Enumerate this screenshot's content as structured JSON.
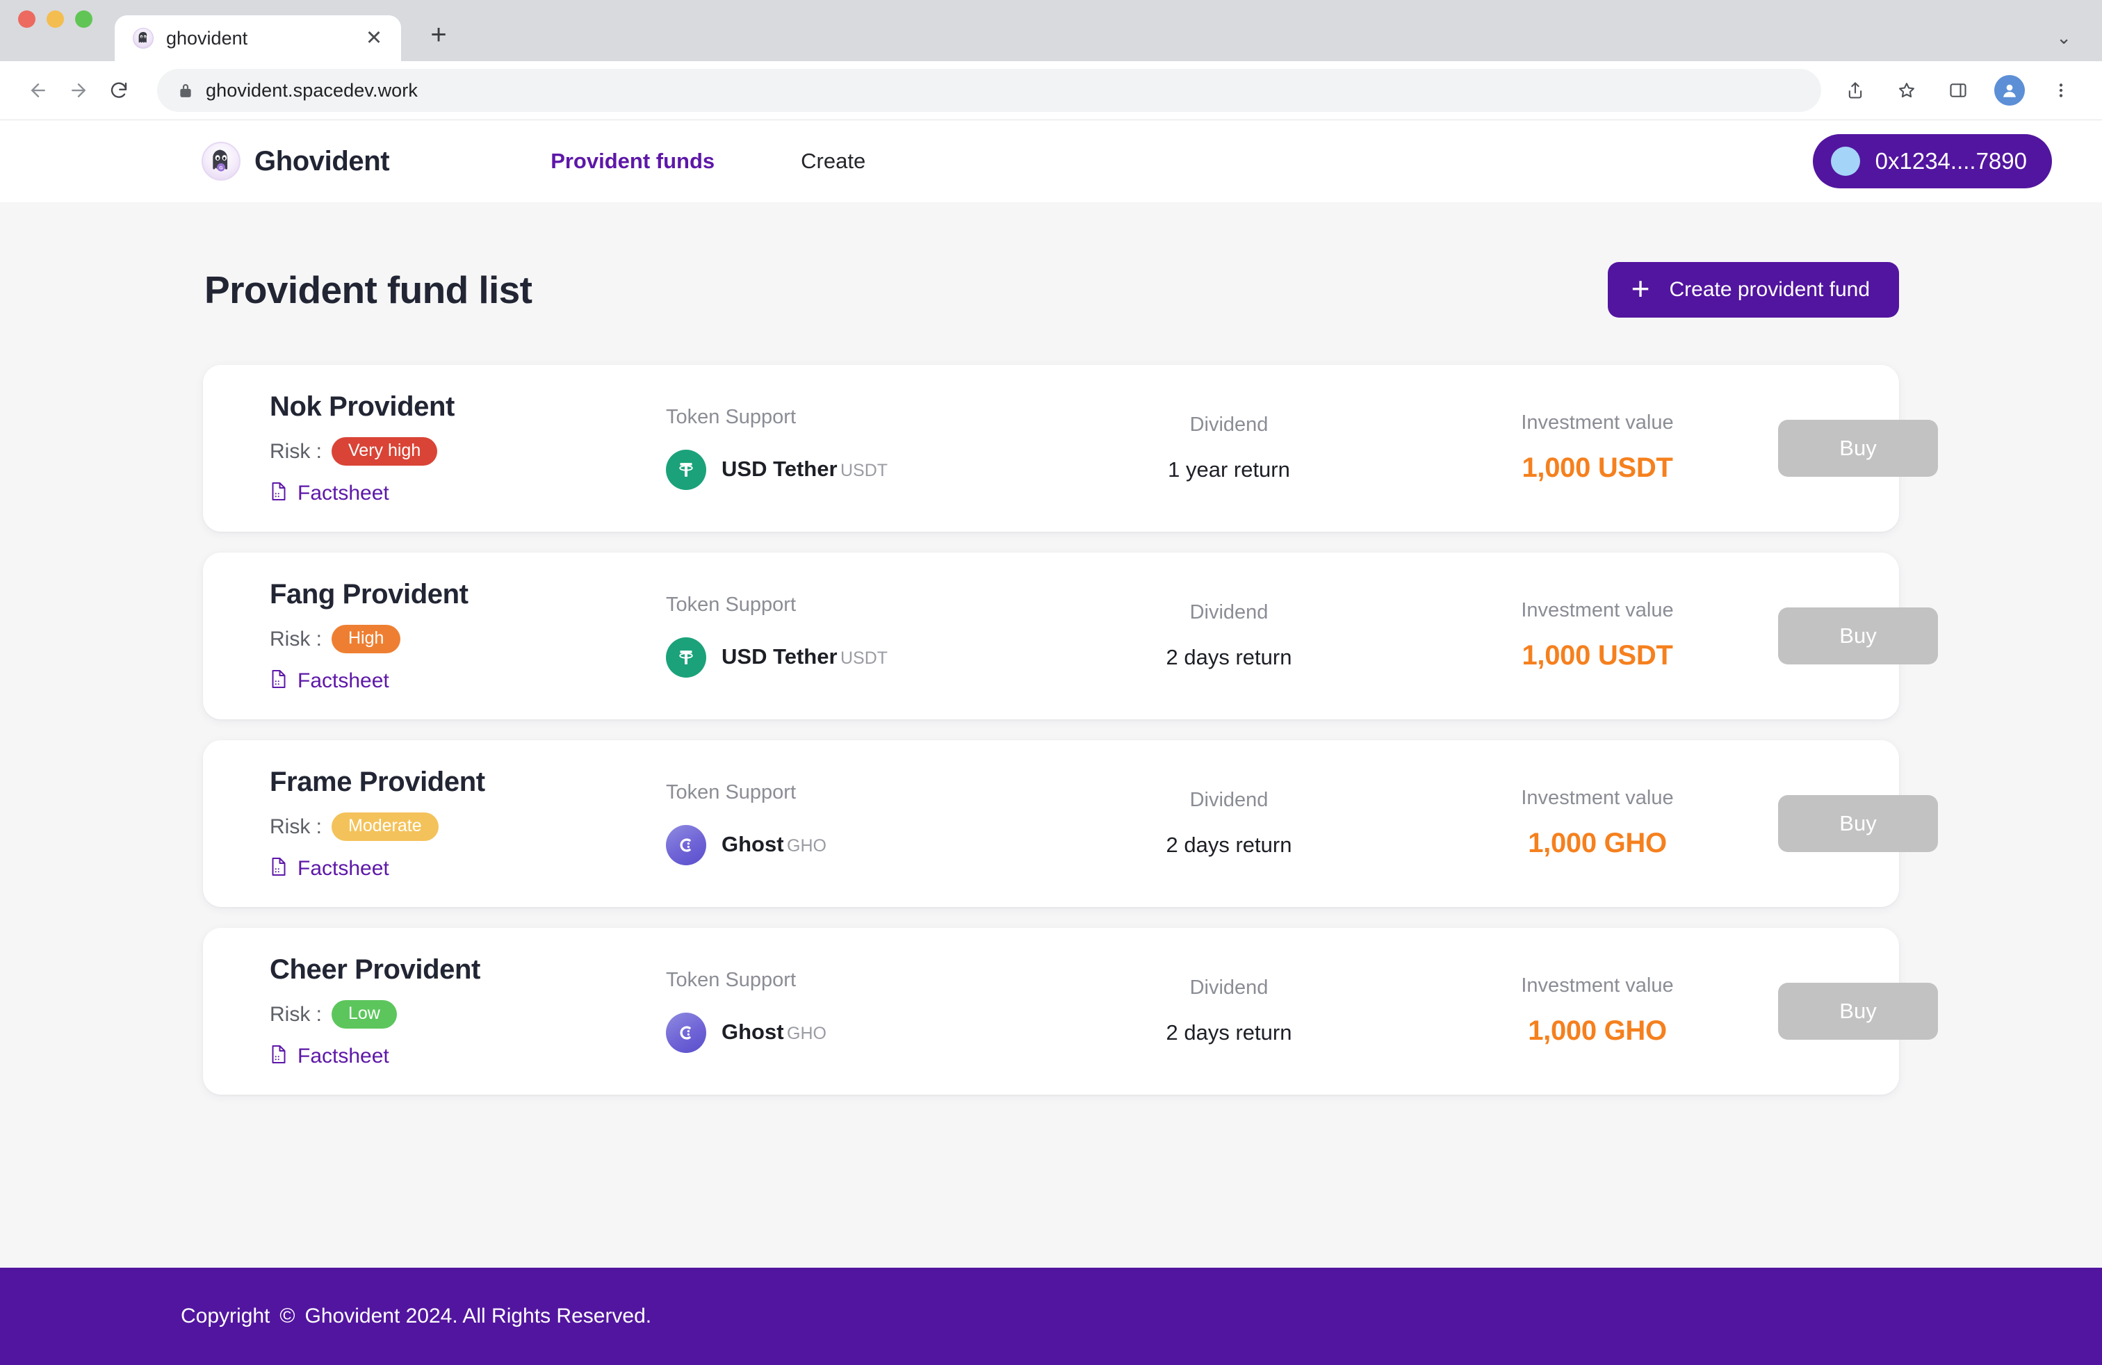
{
  "browser": {
    "tab": {
      "title": "ghovident",
      "favicon_icon": "ghost-avatar-icon",
      "close_icon": "close-icon"
    },
    "new_tab_icon": "plus-icon",
    "tab_list_icon": "chevron-down-icon",
    "back_icon": "arrow-left-icon",
    "forward_icon": "arrow-right-icon",
    "reload_icon": "reload-icon",
    "lock_icon": "lock-icon",
    "url": "ghovident.spacedev.work",
    "share_icon": "share-icon",
    "bookmark_icon": "star-icon",
    "sidepanel_icon": "side-panel-icon",
    "profile_icon": "profile-avatar-icon",
    "menu_icon": "kebab-menu-icon"
  },
  "header": {
    "logo_icon": "ghost-logo-icon",
    "brand": "Ghovident",
    "nav": [
      {
        "label": "Provident funds",
        "active": true
      },
      {
        "label": "Create",
        "active": false
      }
    ],
    "wallet": {
      "avatar_icon": "wallet-avatar-icon",
      "address": "0x1234....7890"
    }
  },
  "main": {
    "title": "Provident fund list",
    "create_button": {
      "icon": "plus-icon",
      "label": "Create provident fund"
    },
    "column_headers": {
      "token": "Token Support",
      "dividend": "Dividend",
      "value": "Investment value"
    },
    "risk_prefix": "Risk :",
    "factsheet_label": "Factsheet",
    "factsheet_icon": "document-icon",
    "buy_label": "Buy",
    "funds": [
      {
        "name": "Nok Provident",
        "risk": "Very high",
        "risk_color": "#d94436",
        "token_name": "USD Tether",
        "token_symbol": "USDT",
        "token_icon": "usdt-icon",
        "dividend": "1 year return",
        "investment_value": "1,000 USDT"
      },
      {
        "name": "Fang Provident",
        "risk": "High",
        "risk_color": "#ee7f32",
        "token_name": "USD Tether",
        "token_symbol": "USDT",
        "token_icon": "usdt-icon",
        "dividend": "2 days return",
        "investment_value": "1,000 USDT"
      },
      {
        "name": "Frame Provident",
        "risk": "Moderate",
        "risk_color": "#f4c25a",
        "token_name": "Ghost",
        "token_symbol": "GHO",
        "token_icon": "gho-icon",
        "dividend": "2 days return",
        "investment_value": "1,000 GHO"
      },
      {
        "name": "Cheer Provident",
        "risk": "Low",
        "risk_color": "#5cc65c",
        "token_name": "Ghost",
        "token_symbol": "GHO",
        "token_icon": "gho-icon",
        "dividend": "2 days return",
        "investment_value": "1,000 GHO"
      }
    ]
  },
  "footer": {
    "copyright_word": "Copyright",
    "copyright_mark": "©",
    "text": "Ghovident 2024. All Rights Reserved."
  },
  "colors": {
    "brand_purple": "#52159f",
    "accent_orange": "#f5801e",
    "link_purple": "#5d17a8",
    "page_bg": "#f6f6f7"
  }
}
